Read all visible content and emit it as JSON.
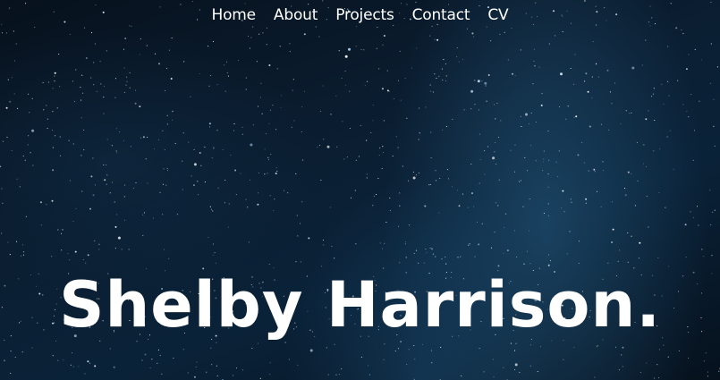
{
  "nav": {
    "items": [
      {
        "label": "Home"
      },
      {
        "label": "About"
      },
      {
        "label": "Projects"
      },
      {
        "label": "Contact"
      },
      {
        "label": "CV"
      }
    ]
  },
  "hero": {
    "title": "Shelby Harrison.",
    "background": "starry-night-sky-image",
    "colors": {
      "text": "#ffffff",
      "sky_dark": "#050b14",
      "milky_way": "#265c82"
    }
  }
}
